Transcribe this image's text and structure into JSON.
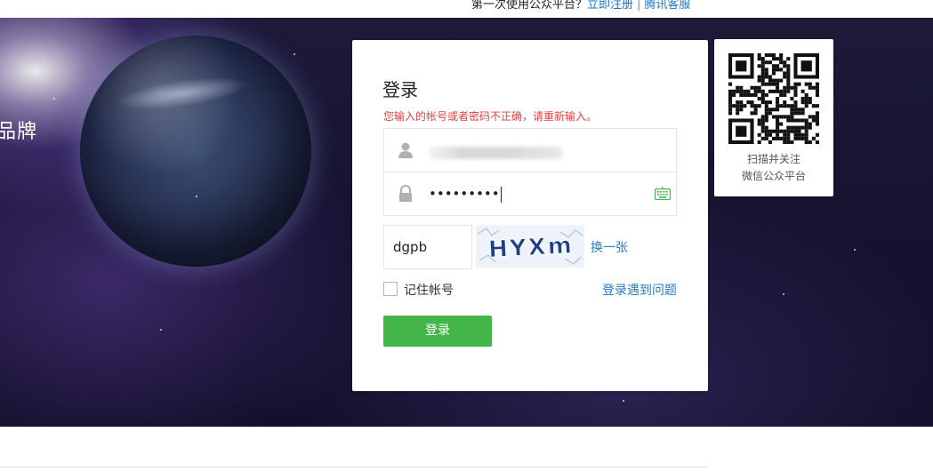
{
  "topbar": {
    "prompt": "第一次使用公众平台？",
    "register_link": "立即注册",
    "separator": "|",
    "support_link": "腾讯客服"
  },
  "banner": {
    "brand_text": "品牌"
  },
  "login": {
    "title": "登录",
    "error_message": "您输入的帐号或者密码不正确，请重新输入。",
    "username_value": "",
    "password_value": "•••••••••",
    "captcha_value": "dgpb",
    "captcha_image_text": "HYXm",
    "captcha_refresh_label": "换一张",
    "remember_label": "记住帐号",
    "remember_checked": false,
    "help_link": "登录遇到问题",
    "submit_label": "登录"
  },
  "qr": {
    "caption_line1": "扫描并关注",
    "caption_line2": "微信公众平台"
  },
  "colors": {
    "accent_green": "#44b549",
    "link_blue": "#2a7bc8",
    "error_red": "#e64340"
  },
  "icons": {
    "user": "user-icon",
    "lock": "lock-icon",
    "keyboard": "keyboard-icon",
    "qr": "qr-code-icon"
  }
}
